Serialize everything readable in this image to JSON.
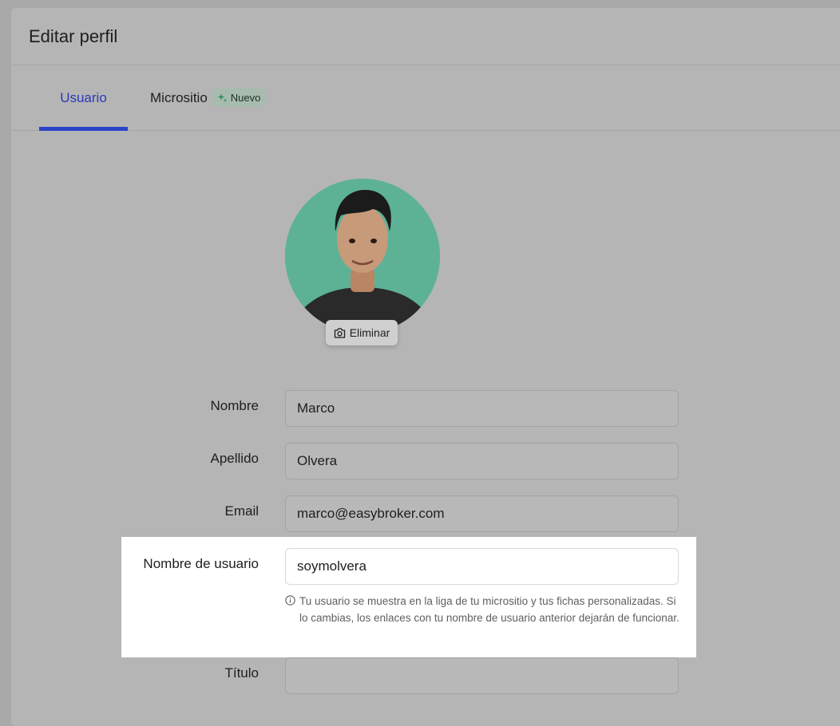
{
  "header": {
    "title": "Editar perfil"
  },
  "tabs": [
    {
      "label": "Usuario",
      "active": true
    },
    {
      "label": "Micrositio",
      "badge": "Nuevo"
    }
  ],
  "avatar": {
    "delete_label": "Eliminar"
  },
  "form": {
    "nombre": {
      "label": "Nombre",
      "value": "Marco"
    },
    "apellido": {
      "label": "Apellido",
      "value": "Olvera"
    },
    "email": {
      "label": "Email",
      "value": "marco@easybroker.com"
    },
    "usuario": {
      "label": "Nombre de usuario",
      "value": "soymolvera",
      "help": "Tu usuario se muestra en la liga de tu micrositio y tus fichas personalizadas. Si lo cambias, los enlaces con tu nombre de usuario anterior dejarán de funcionar."
    },
    "titulo": {
      "label": "Título",
      "value": ""
    }
  },
  "colors": {
    "accent": "#2b44c9",
    "badge_bg": "#a7bcae",
    "avatar_bg": "#5db296"
  },
  "icons": {
    "badge": "sparkle-icon",
    "delete": "camera-icon",
    "help": "info-icon"
  }
}
